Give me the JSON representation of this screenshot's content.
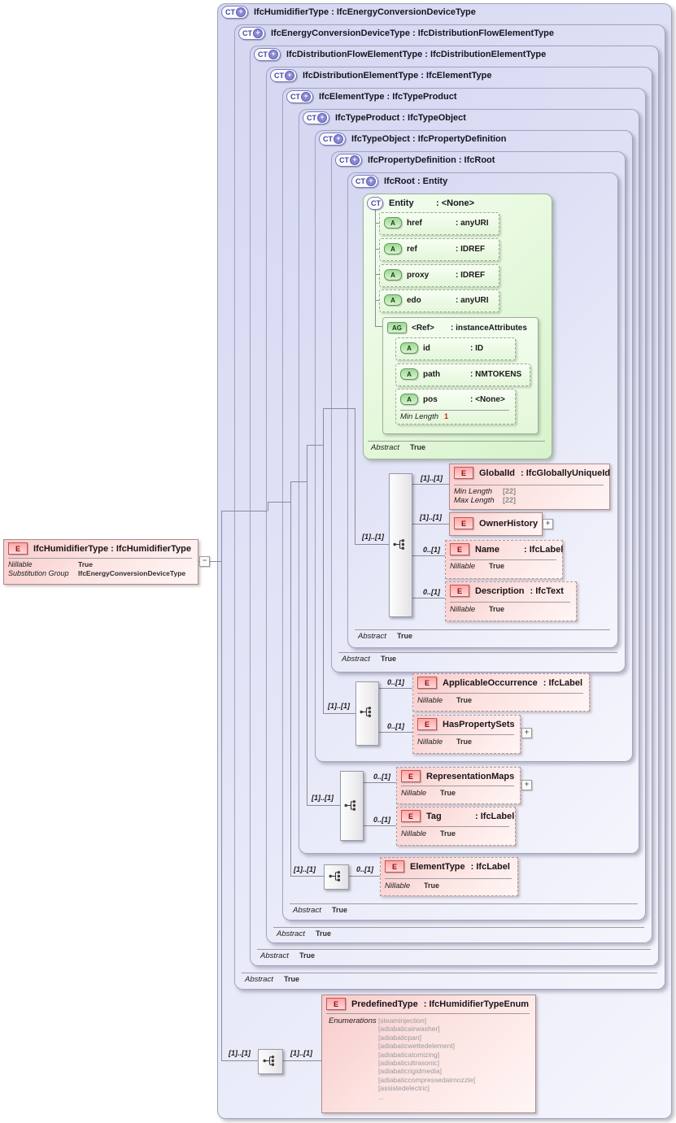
{
  "left_element": {
    "icon": "E",
    "title": "IfcHumidifierType : IfcHumidifierType",
    "rows": [
      {
        "label": "Nillable",
        "value": "True"
      },
      {
        "label": "Substitution Group",
        "value": "IfcEnergyConversionDeviceType"
      }
    ],
    "collapse_glyph": "−"
  },
  "ct_icon_label": "CT",
  "ct_plus_glyph": "+",
  "expand_glyph": "+",
  "ct_boxes": [
    {
      "title": "IfcHumidifierType : IfcEnergyConversionDeviceType"
    },
    {
      "title": "IfcEnergyConversionDeviceType : IfcDistributionFlowElementType",
      "abstract": {
        "label": "Abstract",
        "value": "True"
      }
    },
    {
      "title": "IfcDistributionFlowElementType : IfcDistributionElementType",
      "abstract": {
        "label": "Abstract",
        "value": "True"
      }
    },
    {
      "title": "IfcDistributionElementType : IfcElementType",
      "abstract": {
        "label": "Abstract",
        "value": "True"
      }
    },
    {
      "title": "IfcElementType : IfcTypeProduct",
      "abstract": {
        "label": "Abstract",
        "value": "True"
      }
    },
    {
      "title": "IfcTypeProduct : IfcTypeObject"
    },
    {
      "title": "IfcTypeObject : IfcPropertyDefinition"
    },
    {
      "title": "IfcPropertyDefinition : IfcRoot",
      "abstract": {
        "label": "Abstract",
        "value": "True"
      }
    },
    {
      "title": "IfcRoot : Entity",
      "abstract": {
        "label": "Abstract",
        "value": "True"
      }
    }
  ],
  "entity": {
    "icon": "CT",
    "name": "Entity",
    "type": ": <None>",
    "abstract": {
      "label": "Abstract",
      "value": "True"
    },
    "attributes": [
      {
        "icon": "A",
        "name": "href",
        "type": ": anyURI"
      },
      {
        "icon": "A",
        "name": "ref",
        "type": ": IDREF"
      },
      {
        "icon": "A",
        "name": "proxy",
        "type": ": IDREF"
      },
      {
        "icon": "A",
        "name": "edo",
        "type": ": anyURI"
      }
    ],
    "ref_group": {
      "icon": "AG",
      "name": "<Ref>",
      "type": ": instanceAttributes",
      "attributes": [
        {
          "icon": "A",
          "name": "id",
          "type": ": ID"
        },
        {
          "icon": "A",
          "name": "path",
          "type": ": NMTOKENS"
        },
        {
          "icon": "A",
          "name": "pos",
          "type": ": <None>"
        }
      ],
      "pos_facet": {
        "label": "Min Length",
        "value": "1"
      }
    }
  },
  "sequence_cards": {
    "root_left": "[1]..[1]",
    "global_id": "[1]..[1]",
    "owner_history": "[1]..[1]",
    "name": "0..[1]",
    "description": "0..[1]",
    "type_object_left": "[1]..[1]",
    "applicable_occurrence": "0..[1]",
    "has_property_sets": "0..[1]",
    "type_product_left": "[1]..[1]",
    "representation_maps": "0..[1]",
    "tag": "0..[1]",
    "element_type_left": "[1]..[1]",
    "element_type": "0..[1]",
    "predefined_left": "[1]..[1]",
    "predefined_right": "[1]..[1]"
  },
  "elements": {
    "global_id": {
      "icon": "E",
      "name": "GlobalId",
      "type": ": IfcGloballyUniqueId",
      "facets": [
        {
          "label": "Min Length",
          "value": "[22]"
        },
        {
          "label": "Max Length",
          "value": "[22]"
        }
      ]
    },
    "owner_history": {
      "icon": "E",
      "name": "OwnerHistory"
    },
    "name": {
      "icon": "E",
      "name": "Name",
      "type": ": IfcLabel",
      "facets": [
        {
          "label": "Nillable",
          "value": "True"
        }
      ]
    },
    "description": {
      "icon": "E",
      "name": "Description",
      "type": ": IfcText",
      "facets": [
        {
          "label": "Nillable",
          "value": "True"
        }
      ]
    },
    "applicable_occurrence": {
      "icon": "E",
      "name": "ApplicableOccurrence",
      "type": ": IfcLabel",
      "facets": [
        {
          "label": "Nillable",
          "value": "True"
        }
      ]
    },
    "has_property_sets": {
      "icon": "E",
      "name": "HasPropertySets",
      "facets": [
        {
          "label": "Nillable",
          "value": "True"
        }
      ]
    },
    "representation_maps": {
      "icon": "E",
      "name": "RepresentationMaps",
      "facets": [
        {
          "label": "Nillable",
          "value": "True"
        }
      ]
    },
    "tag": {
      "icon": "E",
      "name": "Tag",
      "type": ": IfcLabel",
      "facets": [
        {
          "label": "Nillable",
          "value": "True"
        }
      ]
    },
    "element_type": {
      "icon": "E",
      "name": "ElementType",
      "type": ": IfcLabel",
      "facets": [
        {
          "label": "Nillable",
          "value": "True"
        }
      ]
    },
    "predefined_type": {
      "icon": "E",
      "name": "PredefinedType",
      "type": ": IfcHumidifierTypeEnum",
      "enumerations_label": "Enumerations",
      "enumerations": [
        "[steaminjection]",
        "[adiabaticairwasher]",
        "[adiabaticpan]",
        "[adiabaticwettedelement]",
        "[adiabaticatomizing]",
        "[adiabaticultrasonic]",
        "[adiabaticrigidmedia]",
        "[adiabaticcompressedairnozzle]",
        "[assistedelectric]",
        "..."
      ]
    }
  }
}
